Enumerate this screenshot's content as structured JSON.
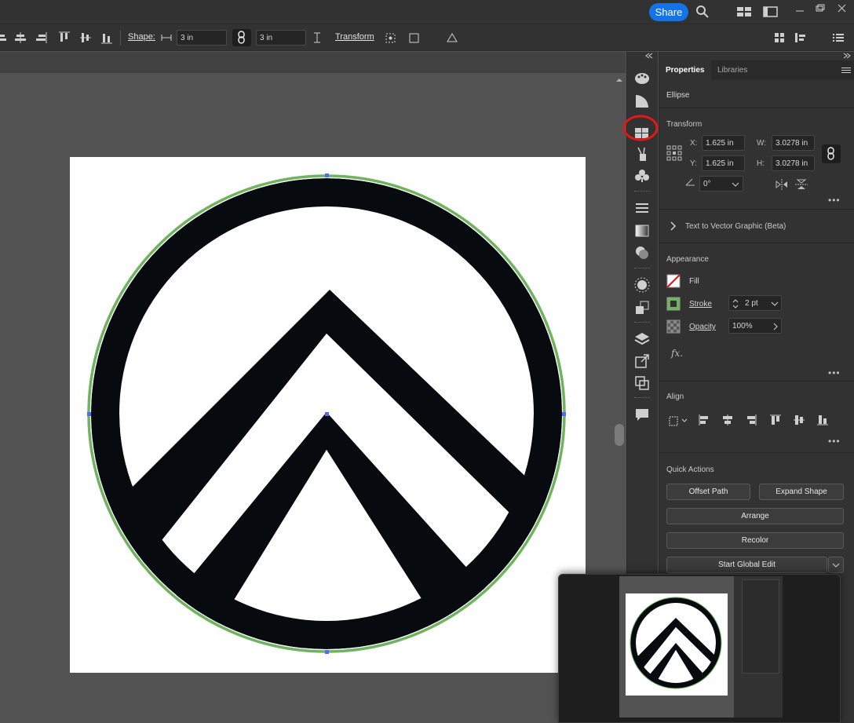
{
  "toolbar": {
    "share_label": "Share",
    "shape_label": "Shape:",
    "width_value": "3 in",
    "height_value": "3 in",
    "transform_label": "Transform"
  },
  "panel": {
    "tabs": [
      "Properties",
      "Libraries"
    ],
    "object_type": "Ellipse",
    "transform": {
      "heading": "Transform",
      "x_label": "X:",
      "x_value": "1.625 in",
      "y_label": "Y:",
      "y_value": "1.625 in",
      "w_label": "W:",
      "w_value": "3.0278 in",
      "h_label": "H:",
      "h_value": "3.0278 in",
      "angle_value": "0°"
    },
    "text_to_vector": "Text to Vector Graphic (Beta)",
    "appearance": {
      "heading": "Appearance",
      "fill_label": "Fill",
      "stroke_label": "Stroke",
      "stroke_value": "2 pt",
      "opacity_label": "Opacity",
      "opacity_value": "100%",
      "fx_label": "fx."
    },
    "align": {
      "heading": "Align"
    },
    "quick_actions": {
      "heading": "Quick Actions",
      "offset_path": "Offset Path",
      "expand_shape": "Expand Shape",
      "arrange": "Arrange",
      "recolor": "Recolor",
      "start_global_edit": "Start Global Edit"
    }
  },
  "colors": {
    "accent": "#1473e6",
    "stroke_green": "#6fb35f",
    "highlight_red": "#e01818"
  }
}
